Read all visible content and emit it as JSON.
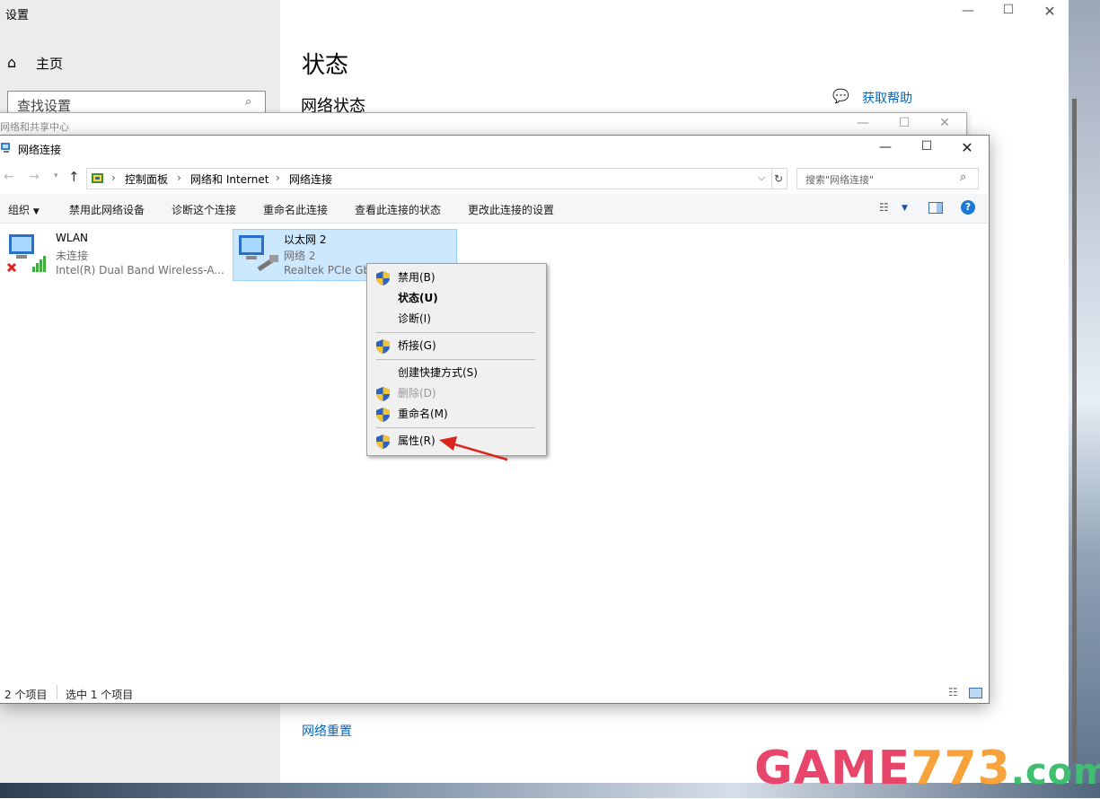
{
  "settings": {
    "window_title": "设置",
    "home_label": "主页",
    "search_placeholder": "查找设置",
    "page_title": "状态",
    "section_title": "网络状态",
    "help_link": "获取帮助",
    "reset_link": "网络重置"
  },
  "nsc": {
    "title": "网络和共享中心"
  },
  "explorer": {
    "title": "网络连接",
    "breadcrumb": [
      "控制面板",
      "网络和 Internet",
      "网络连接"
    ],
    "search_placeholder": "搜索\"网络连接\"",
    "toolbar": {
      "organize": "组织",
      "disable": "禁用此网络设备",
      "diagnose": "诊断这个连接",
      "rename": "重命名此连接",
      "view_status": "查看此连接的状态",
      "change_settings": "更改此连接的设置"
    },
    "connections": [
      {
        "name": "WLAN",
        "status": "未连接",
        "device": "Intel(R) Dual Band Wireless-A..."
      },
      {
        "name": "以太网 2",
        "status": "网络 2",
        "device": "Realtek PCIe Gb"
      }
    ],
    "statusbar": {
      "count": "2 个项目",
      "selected": "选中 1 个项目"
    }
  },
  "context_menu": {
    "items": [
      {
        "label": "禁用(B)",
        "shield": true,
        "bold": false,
        "disabled": false
      },
      {
        "label": "状态(U)",
        "shield": false,
        "bold": true,
        "disabled": false
      },
      {
        "label": "诊断(I)",
        "shield": false,
        "bold": false,
        "disabled": false
      },
      {
        "label": "桥接(G)",
        "shield": true,
        "bold": false,
        "disabled": false
      },
      {
        "label": "创建快捷方式(S)",
        "shield": false,
        "bold": false,
        "disabled": false
      },
      {
        "label": "删除(D)",
        "shield": true,
        "bold": false,
        "disabled": true
      },
      {
        "label": "重命名(M)",
        "shield": true,
        "bold": false,
        "disabled": false
      },
      {
        "label": "属性(R)",
        "shield": true,
        "bold": false,
        "disabled": false
      }
    ]
  },
  "watermark": "GAME773.com",
  "colors": {
    "accent_link": "#0067c0",
    "selection_bg": "#cce8ff",
    "selection_border": "#99d1ff",
    "arrow_red": "#d9251c",
    "help_blue": "#1e78d6"
  }
}
